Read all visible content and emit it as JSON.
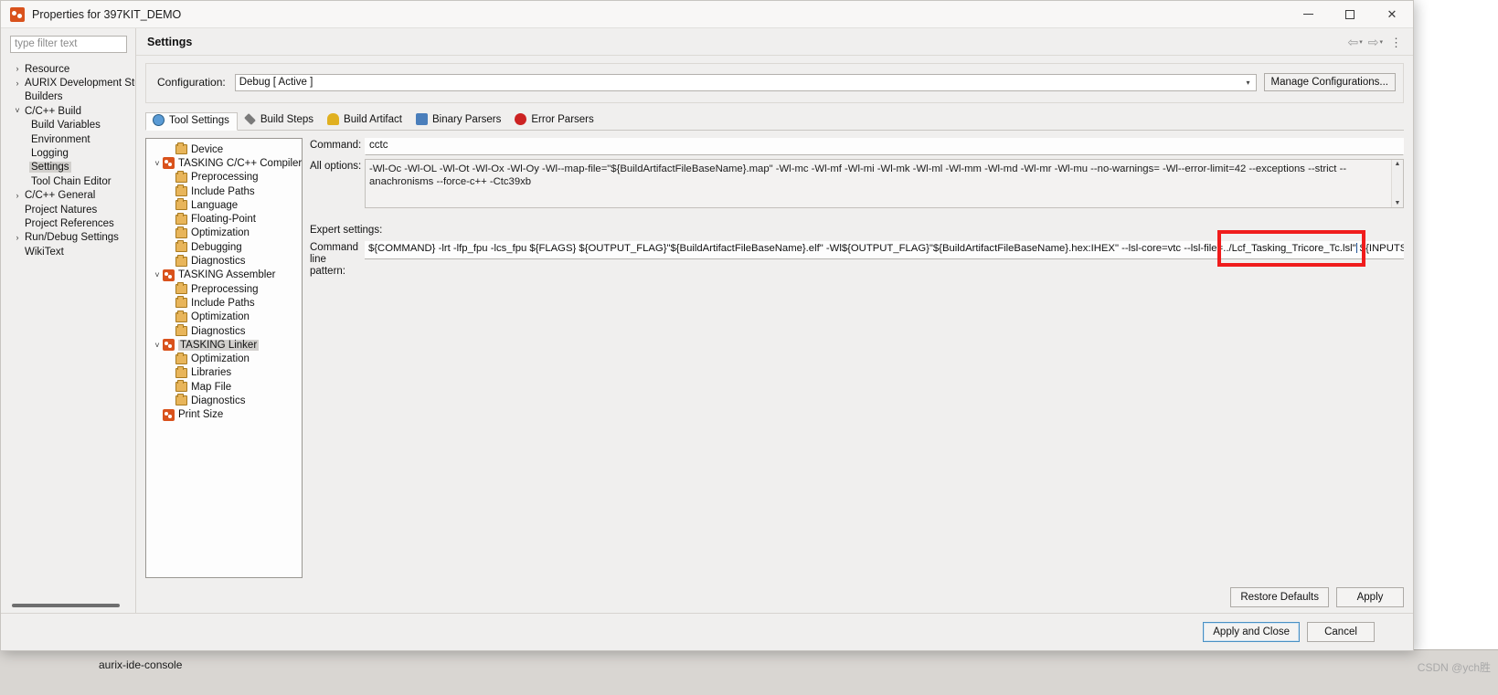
{
  "window": {
    "title": "Properties for 397KIT_DEMO",
    "icon": "tasking-app-icon",
    "minimize_label": "–",
    "maximize_label": "□",
    "close_label": "✕"
  },
  "left_pane": {
    "filter_placeholder": "type filter text",
    "filter_value": "",
    "tree": [
      {
        "label": "Resource",
        "twisty": "›",
        "level": 1,
        "selected": false
      },
      {
        "label": "AURIX Development Stuc",
        "twisty": "›",
        "level": 1,
        "selected": false
      },
      {
        "label": "Builders",
        "twisty": "",
        "level": 1,
        "selected": false
      },
      {
        "label": "C/C++ Build",
        "twisty": "˅",
        "level": 1,
        "selected": false
      },
      {
        "label": "Build Variables",
        "twisty": "",
        "level": 2,
        "selected": false
      },
      {
        "label": "Environment",
        "twisty": "",
        "level": 2,
        "selected": false
      },
      {
        "label": "Logging",
        "twisty": "",
        "level": 2,
        "selected": false
      },
      {
        "label": "Settings",
        "twisty": "",
        "level": 2,
        "selected": true
      },
      {
        "label": "Tool Chain Editor",
        "twisty": "",
        "level": 2,
        "selected": false
      },
      {
        "label": "C/C++ General",
        "twisty": "›",
        "level": 1,
        "selected": false
      },
      {
        "label": "Project Natures",
        "twisty": "",
        "level": 1,
        "selected": false
      },
      {
        "label": "Project References",
        "twisty": "",
        "level": 1,
        "selected": false
      },
      {
        "label": "Run/Debug Settings",
        "twisty": "›",
        "level": 1,
        "selected": false
      },
      {
        "label": "WikiText",
        "twisty": "",
        "level": 1,
        "selected": false
      }
    ]
  },
  "page": {
    "title": "Settings",
    "header_tools": {
      "back_icon": "⇦",
      "back_caret": "▾",
      "forward_icon": "⇨",
      "forward_caret": "▾",
      "menu_icon": "⋮"
    }
  },
  "configuration": {
    "label": "Configuration:",
    "value": "Debug  [ Active ]",
    "caret": "▾",
    "manage_button": "Manage Configurations..."
  },
  "tabs": [
    {
      "label": "Tool Settings",
      "icon": "globe-icon",
      "active": true
    },
    {
      "label": "Build Steps",
      "icon": "wrench-icon",
      "active": false
    },
    {
      "label": "Build Artifact",
      "icon": "gold-artifact-icon",
      "active": false
    },
    {
      "label": "Binary Parsers",
      "icon": "binary-parser-icon",
      "active": false
    },
    {
      "label": "Error Parsers",
      "icon": "error-parser-icon",
      "active": false
    }
  ],
  "tool_tree": [
    {
      "label": "Device",
      "twisty": "",
      "icon": "folder-icon",
      "depth": 1,
      "selected": false
    },
    {
      "label": "TASKING C/C++ Compiler",
      "twisty": "˅",
      "icon": "tasking-icon",
      "depth": 0,
      "selected": false
    },
    {
      "label": "Preprocessing",
      "twisty": "",
      "icon": "folder-icon",
      "depth": 1,
      "selected": false
    },
    {
      "label": "Include Paths",
      "twisty": "",
      "icon": "folder-icon",
      "depth": 1,
      "selected": false
    },
    {
      "label": "Language",
      "twisty": "",
      "icon": "folder-icon",
      "depth": 1,
      "selected": false
    },
    {
      "label": "Floating-Point",
      "twisty": "",
      "icon": "folder-icon",
      "depth": 1,
      "selected": false
    },
    {
      "label": "Optimization",
      "twisty": "",
      "icon": "folder-icon",
      "depth": 1,
      "selected": false
    },
    {
      "label": "Debugging",
      "twisty": "",
      "icon": "folder-icon",
      "depth": 1,
      "selected": false
    },
    {
      "label": "Diagnostics",
      "twisty": "",
      "icon": "folder-icon",
      "depth": 1,
      "selected": false
    },
    {
      "label": "TASKING Assembler",
      "twisty": "˅",
      "icon": "tasking-icon",
      "depth": 0,
      "selected": false
    },
    {
      "label": "Preprocessing",
      "twisty": "",
      "icon": "folder-icon",
      "depth": 1,
      "selected": false
    },
    {
      "label": "Include Paths",
      "twisty": "",
      "icon": "folder-icon",
      "depth": 1,
      "selected": false
    },
    {
      "label": "Optimization",
      "twisty": "",
      "icon": "folder-icon",
      "depth": 1,
      "selected": false
    },
    {
      "label": "Diagnostics",
      "twisty": "",
      "icon": "folder-icon",
      "depth": 1,
      "selected": false
    },
    {
      "label": "TASKING Linker",
      "twisty": "˅",
      "icon": "tasking-icon",
      "depth": 0,
      "selected": true
    },
    {
      "label": "Optimization",
      "twisty": "",
      "icon": "folder-icon",
      "depth": 1,
      "selected": false
    },
    {
      "label": "Libraries",
      "twisty": "",
      "icon": "folder-icon",
      "depth": 1,
      "selected": false
    },
    {
      "label": "Map File",
      "twisty": "",
      "icon": "folder-icon",
      "depth": 1,
      "selected": false
    },
    {
      "label": "Diagnostics",
      "twisty": "",
      "icon": "folder-icon",
      "depth": 1,
      "selected": false
    },
    {
      "label": "Print Size",
      "twisty": "",
      "icon": "tasking-icon",
      "depth": 0,
      "selected": false
    }
  ],
  "settings": {
    "command_label": "Command:",
    "command_value": "cctc",
    "all_options_label": "All options:",
    "all_options_value": "-Wl-Oc -Wl-OL -Wl-Ot -Wl-Ox -Wl-Oy -Wl--map-file=\"${BuildArtifactFileBaseName}.map\" -Wl-mc -Wl-mf -Wl-mi -Wl-mk -Wl-ml -Wl-mm -Wl-md -Wl-mr -Wl-mu --no-warnings= -Wl--error-limit=42 --exceptions --strict --anachronisms --force-c++ -Ctc39xb",
    "scroll_up_icon": "▲",
    "scroll_down_icon": "▼",
    "expert_label": "Expert settings:",
    "clp_label_line1": "Command",
    "clp_label_line2": "line pattern:",
    "clp_value_before": "${COMMAND} -lrt -lfp_fpu -lcs_fpu  ${FLAGS}   ${OUTPUT_FLAG}\"${BuildArtifactFileBaseName}.elf\" -Wl${OUTPUT_FLAG}\"${BuildArtifactFileBaseName}.hex:IHEX\" --lsl-core=vtc  --lsl-file=",
    "clp_value_highlight": "../Lcf_Tasking_Tricore_Tc.lsl\"",
    "clp_value_after": " ${INPUTS}",
    "highlight_color": "#f01c1c"
  },
  "buttons": {
    "restore_defaults": "Restore Defaults",
    "apply": "Apply",
    "apply_and_close": "Apply and Close",
    "cancel": "Cancel"
  },
  "background": {
    "console_tab": "aurix-ide-console",
    "console_sub": "",
    "watermark": "CSDN @ych胜"
  }
}
